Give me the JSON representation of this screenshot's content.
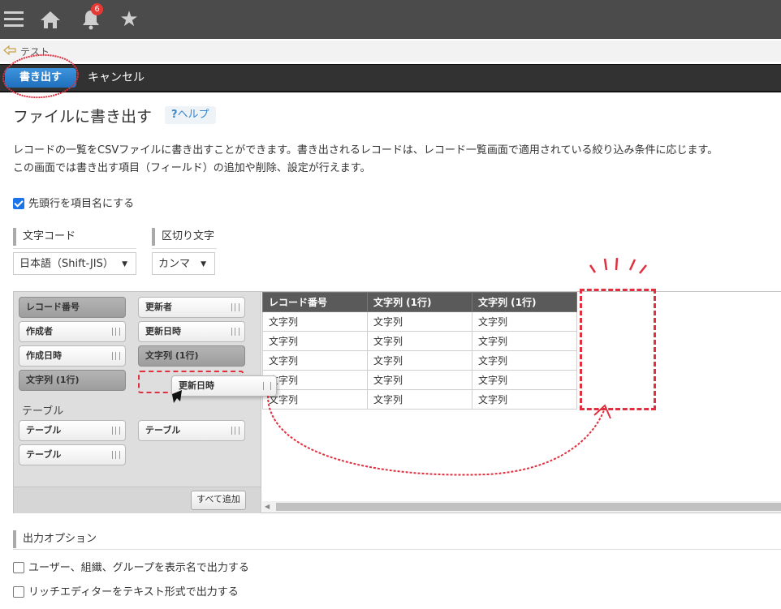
{
  "header": {
    "notification_count": "6",
    "icons": [
      "menu-icon",
      "home-icon",
      "bell-icon",
      "star-icon"
    ]
  },
  "breadcrumb": {
    "app_name": "テスト"
  },
  "toolbar": {
    "export_label": "書き出す",
    "cancel_label": "キャンセル"
  },
  "page": {
    "title": "ファイルに書き出す",
    "help_mark": "?",
    "help_label": "ヘルプ",
    "description_1": "レコードの一覧をCSVファイルに書き出すことができます。書き出されるレコードは、レコード一覧画面で適用されている絞り込み条件に応じます。",
    "description_2": "この画面では書き出す項目（フィールド）の追加や削除、設定が行えます。"
  },
  "header_row_option": {
    "label": "先頭行を項目名にする",
    "checked": true
  },
  "encoding": {
    "label": "文字コード",
    "value": "日本語（Shift-JIS）"
  },
  "delimiter": {
    "label": "区切り文字",
    "value": "カンマ"
  },
  "field_palette": {
    "fields": [
      {
        "label": "レコード番号",
        "used": true
      },
      {
        "label": "更新者",
        "used": false
      },
      {
        "label": "作成者",
        "used": false
      },
      {
        "label": "更新日時",
        "used": false
      },
      {
        "label": "作成日時",
        "used": false
      },
      {
        "label": "文字列 (1行)",
        "used": true
      },
      {
        "label": "文字列 (1行)",
        "used": true
      }
    ],
    "table_section_label": "テーブル",
    "table_fields": [
      "テーブル",
      "テーブル",
      "テーブル"
    ],
    "add_all_label": "すべて追加",
    "dragging_label": "更新日時"
  },
  "preview": {
    "columns": [
      "レコード番号",
      "文字列 (1行)",
      "文字列 (1行)"
    ],
    "rows": [
      [
        "文字列",
        "文字列",
        "文字列"
      ],
      [
        "文字列",
        "文字列",
        "文字列"
      ],
      [
        "文字列",
        "文字列",
        "文字列"
      ],
      [
        "文字列",
        "文字列",
        "文字列"
      ],
      [
        "文字列",
        "文字列",
        "文字列"
      ]
    ]
  },
  "output_options": {
    "title": "出力オプション",
    "items": [
      {
        "label": "ユーザー、組織、グループを表示名で出力する",
        "checked": false
      },
      {
        "label": "リッチエディターをテキスト形式で出力する",
        "checked": false
      }
    ]
  },
  "colors": {
    "accent": "#1f6fbd",
    "annotation": "#e03040",
    "topbar": "#4b4b4b"
  }
}
